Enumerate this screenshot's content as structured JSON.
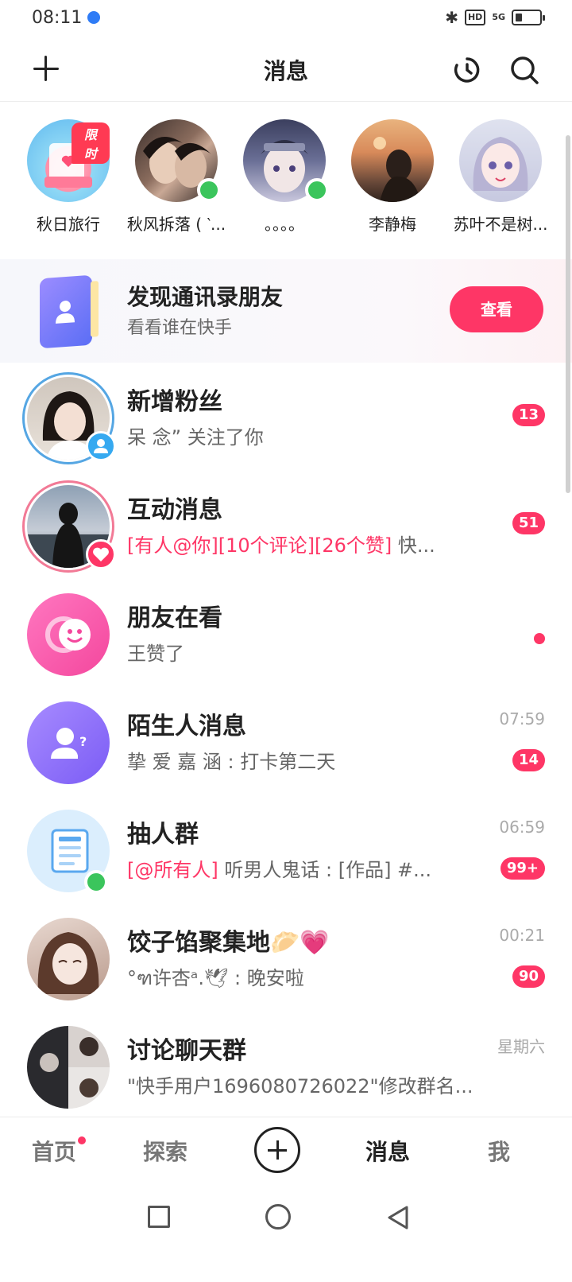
{
  "status_bar": {
    "time": "08:11",
    "hd": "HD",
    "signal": "5G"
  },
  "header": {
    "title": "消息"
  },
  "stories": [
    {
      "name": "秋日旅行",
      "tag": "限时"
    },
    {
      "name": "秋风拆落 ( ‵..."
    },
    {
      "name": "。。。。"
    },
    {
      "name": "李静梅"
    },
    {
      "name": "苏叶不是树..."
    }
  ],
  "banner": {
    "title": "发现通讯录朋友",
    "subtitle": "看看谁在快手",
    "button": "查看"
  },
  "rows": [
    {
      "title": "新增粉丝",
      "subtitle": "呆  念” 关注了你",
      "badge": "13"
    },
    {
      "title": "互动消息",
      "highlight": "[有人@你][10个评论][26个赞]",
      "subtitle": " 快...",
      "badge": "51"
    },
    {
      "title": "朋友在看",
      "subtitle": "王赞了"
    },
    {
      "title": "陌生人消息",
      "subtitle": "挚  爱  嘉  涵 : 打卡第二天",
      "time": "07:59",
      "badge": "14"
    },
    {
      "title": "抽人群",
      "highlight": "[@所有人]",
      "subtitle": " 听男人鬼话 : [作品] #...",
      "time": "06:59",
      "badge": "99+"
    },
    {
      "title": "饺子馅聚集地🥟💗",
      "subtitle": "°ฑ许杏ᵃ.🕊 : 晚安啦",
      "time": "00:21",
      "badge": "90"
    },
    {
      "title": "讨论聊天群",
      "subtitle": "\"快手用户1696080726022\"修改群名...",
      "time": "星期六"
    }
  ],
  "bottom_nav": {
    "home": "首页",
    "explore": "探索",
    "messages": "消息",
    "me": "我"
  },
  "colors": {
    "accent": "#fe3666",
    "online": "#3bc55c"
  }
}
